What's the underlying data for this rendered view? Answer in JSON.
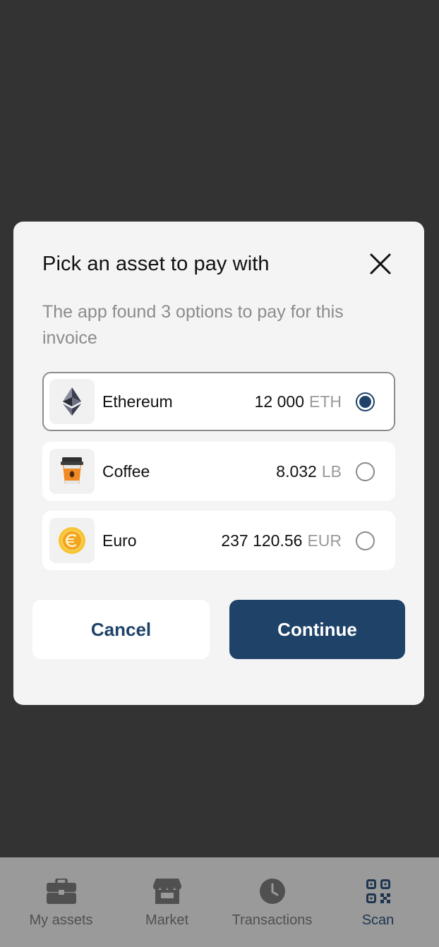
{
  "dialog": {
    "title": "Pick an asset to pay with",
    "subtitle": "The app found 3 options to pay for this invoice",
    "options": [
      {
        "name": "Ethereum",
        "amount": "12 000",
        "unit": "ETH",
        "selected": true,
        "icon": "ethereum-icon"
      },
      {
        "name": "Coffee",
        "amount": "8.032",
        "unit": "LB",
        "selected": false,
        "icon": "coffee-cup-icon"
      },
      {
        "name": "Euro",
        "amount": "237 120.56",
        "unit": "EUR",
        "selected": false,
        "icon": "euro-coin-icon"
      }
    ],
    "cancel_label": "Cancel",
    "continue_label": "Continue"
  },
  "nav": {
    "items": [
      {
        "label": "My assets",
        "icon": "briefcase-icon"
      },
      {
        "label": "Market",
        "icon": "store-icon"
      },
      {
        "label": "Transactions",
        "icon": "clock-icon"
      },
      {
        "label": "Scan",
        "icon": "qr-code-icon",
        "active": true
      }
    ]
  },
  "colors": {
    "backdrop": "#333333",
    "dialog_bg": "#f4f4f4",
    "accent": "#1e4268",
    "nav_bg": "#9a9a9a"
  }
}
